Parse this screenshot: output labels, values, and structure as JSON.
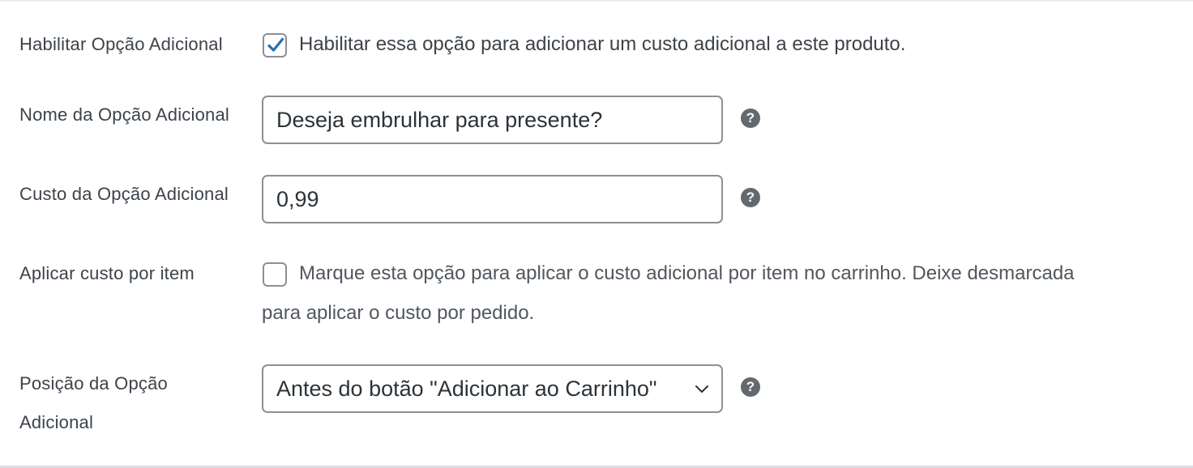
{
  "rows": {
    "enable": {
      "label": "Habilitar Opção Adicional",
      "checked": true,
      "description": "Habilitar essa opção para adicionar um custo adicional a este produto."
    },
    "name": {
      "label": "Nome da Opção Adicional",
      "value": "Deseja embrulhar para presente?",
      "help": "?"
    },
    "cost": {
      "label": "Custo da Opção Adicional",
      "value": "0,99",
      "help": "?"
    },
    "per_item": {
      "label": "Aplicar custo por item",
      "checked": false,
      "description_line1": "Marque esta opção para aplicar o custo adicional por item no carrinho. Deixe desmarcada",
      "description_line2": "para aplicar o custo por pedido."
    },
    "position": {
      "label_line1": "Posição da Opção",
      "label_line2": "Adicional",
      "selected": "Antes do botão \"Adicionar ao Carrinho\"",
      "help": "?"
    }
  },
  "icons": {
    "checkmark": "check-icon",
    "help": "question-circle-icon",
    "dropdown": "chevron-down-icon"
  },
  "colors": {
    "accent": "#2271b1",
    "border": "#8c8f94",
    "help_icon": "#646970",
    "text": "#3c434a"
  }
}
